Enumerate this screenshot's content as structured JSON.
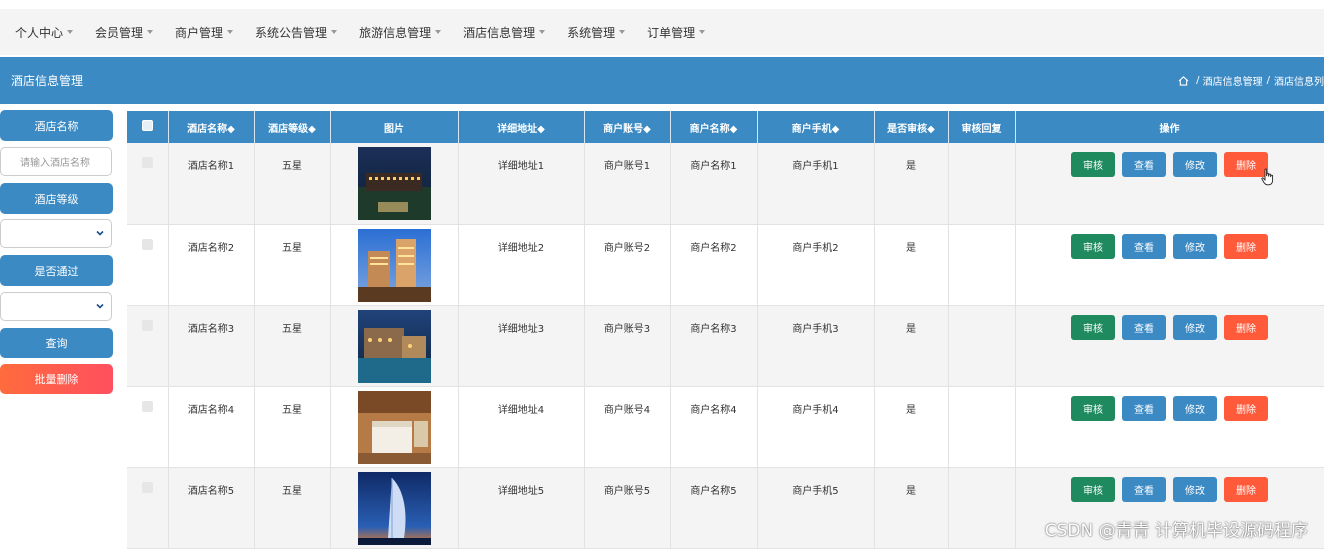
{
  "nav": {
    "items": [
      {
        "label": "个人中心",
        "has_caret": true
      },
      {
        "label": "会员管理",
        "has_caret": true
      },
      {
        "label": "商户管理",
        "has_caret": true
      },
      {
        "label": "系统公告管理",
        "has_caret": true
      },
      {
        "label": "旅游信息管理",
        "has_caret": true
      },
      {
        "label": "酒店信息管理",
        "has_caret": true
      },
      {
        "label": "系统管理",
        "has_caret": true
      },
      {
        "label": "订单管理",
        "has_caret": true
      }
    ]
  },
  "header": {
    "title": "酒店信息管理",
    "breadcrumb": [
      "酒店信息管理",
      "/",
      "酒店信息列"
    ],
    "home_icon": "home-icon"
  },
  "search": {
    "name_label": "酒店名称",
    "name_placeholder": "请输入酒店名称",
    "level_label": "酒店等级",
    "level_value": "",
    "passed_label": "是否通过",
    "passed_value": "",
    "query_button": "查询",
    "batch_delete_button": "批量删除"
  },
  "table": {
    "columns": [
      "酒店名称◆",
      "酒店等级◆",
      "图片",
      "详细地址◆",
      "商户账号◆",
      "商户名称◆",
      "商户手机◆",
      "是否审核◆",
      "审核回复",
      "操作"
    ],
    "actions": {
      "audit": "审核",
      "view": "查看",
      "edit": "修改",
      "delete": "删除"
    },
    "rows": [
      {
        "name": "酒店名称1",
        "level": "五星",
        "address": "详细地址1",
        "account": "商户账号1",
        "merchant": "商户名称1",
        "phone": "商户手机1",
        "audited": "是",
        "reply": "",
        "image": "hotel-night-view"
      },
      {
        "name": "酒店名称2",
        "level": "五星",
        "address": "详细地址2",
        "account": "商户账号2",
        "merchant": "商户名称2",
        "phone": "商户手机2",
        "audited": "是",
        "reply": "",
        "image": "hotel-tower-dusk"
      },
      {
        "name": "酒店名称3",
        "level": "五星",
        "address": "详细地址3",
        "account": "商户账号3",
        "merchant": "商户名称3",
        "phone": "商户手机3",
        "audited": "是",
        "reply": "",
        "image": "hotel-resort-night"
      },
      {
        "name": "酒店名称4",
        "level": "五星",
        "address": "详细地址4",
        "account": "商户账号4",
        "merchant": "商户名称4",
        "phone": "商户手机4",
        "audited": "是",
        "reply": "",
        "image": "hotel-room"
      },
      {
        "name": "酒店名称5",
        "level": "五星",
        "address": "详细地址5",
        "account": "商户账号5",
        "merchant": "商户名称5",
        "phone": "商户手机5",
        "audited": "是",
        "reply": "",
        "image": "burj-al-arab"
      }
    ]
  },
  "watermark": "CSDN @青青  计算机毕设源码程序",
  "colors": {
    "primary": "#3b8ac4",
    "audit": "#1e8a5e",
    "delete": "#ff5a3a",
    "nav_bg": "#f4f4f4"
  }
}
